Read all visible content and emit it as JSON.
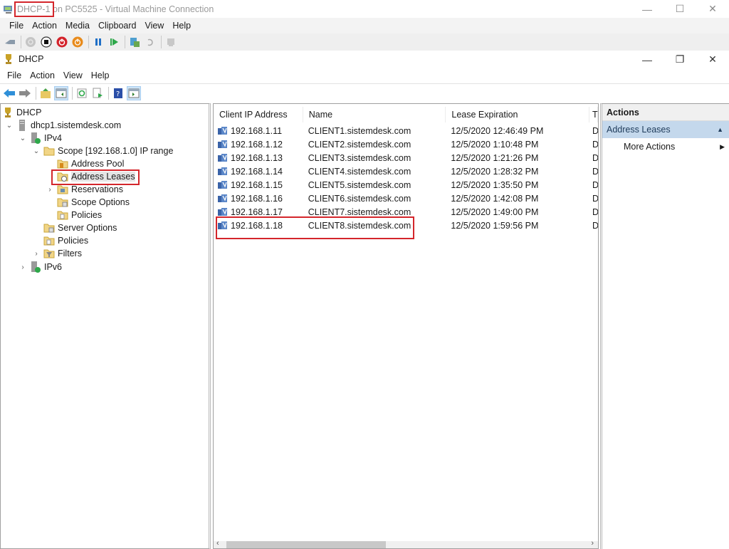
{
  "vm_window": {
    "title_highlight": "DHCP-1",
    "title_rest": " on PC5525 - Virtual Machine Connection",
    "controls": {
      "minimize": "—",
      "maximize": "☐",
      "close": "✕"
    },
    "menu": [
      "File",
      "Action",
      "Media",
      "Clipboard",
      "View",
      "Help"
    ]
  },
  "mmc_window": {
    "title": "DHCP",
    "controls": {
      "minimize": "—",
      "restore": "❐",
      "close": "✕"
    },
    "menu": [
      "File",
      "Action",
      "View",
      "Help"
    ]
  },
  "tree": {
    "root": "DHCP",
    "server": "dhcp1.sistemdesk.com",
    "ipv4": "IPv4",
    "scope": "Scope [192.168.1.0] IP range",
    "address_pool": "Address Pool",
    "address_leases": "Address Leases",
    "reservations": "Reservations",
    "scope_options": "Scope Options",
    "scope_policies": "Policies",
    "server_options": "Server Options",
    "policies": "Policies",
    "filters": "Filters",
    "ipv6": "IPv6"
  },
  "list": {
    "columns": [
      "Client IP Address",
      "Name",
      "Lease Expiration",
      "T"
    ],
    "rows": [
      {
        "ip": "192.168.1.11",
        "name": "CLIENT1.sistemdesk.com",
        "expiration": "12/5/2020 12:46:49 PM",
        "type": "D"
      },
      {
        "ip": "192.168.1.12",
        "name": "CLIENT2.sistemdesk.com",
        "expiration": "12/5/2020 1:10:48 PM",
        "type": "D"
      },
      {
        "ip": "192.168.1.13",
        "name": "CLIENT3.sistemdesk.com",
        "expiration": "12/5/2020 1:21:26 PM",
        "type": "D"
      },
      {
        "ip": "192.168.1.14",
        "name": "CLIENT4.sistemdesk.com",
        "expiration": "12/5/2020 1:28:32 PM",
        "type": "D"
      },
      {
        "ip": "192.168.1.15",
        "name": "CLIENT5.sistemdesk.com",
        "expiration": "12/5/2020 1:35:50 PM",
        "type": "D"
      },
      {
        "ip": "192.168.1.16",
        "name": "CLIENT6.sistemdesk.com",
        "expiration": "12/5/2020 1:42:08 PM",
        "type": "D"
      },
      {
        "ip": "192.168.1.17",
        "name": "CLIENT7.sistemdesk.com",
        "expiration": "12/5/2020 1:49:00 PM",
        "type": "D"
      },
      {
        "ip": "192.168.1.18",
        "name": "CLIENT8.sistemdesk.com",
        "expiration": "12/5/2020 1:59:56 PM",
        "type": "D"
      }
    ],
    "scroll": {
      "left": "‹",
      "right": "›"
    }
  },
  "actions": {
    "header": "Actions",
    "section": "Address Leases",
    "section_arrow": "▲",
    "items": [
      {
        "label": "More Actions",
        "arrow": "▶"
      }
    ]
  },
  "colors": {
    "highlight": "#d4262b",
    "section_bg": "#c4d8ec"
  }
}
